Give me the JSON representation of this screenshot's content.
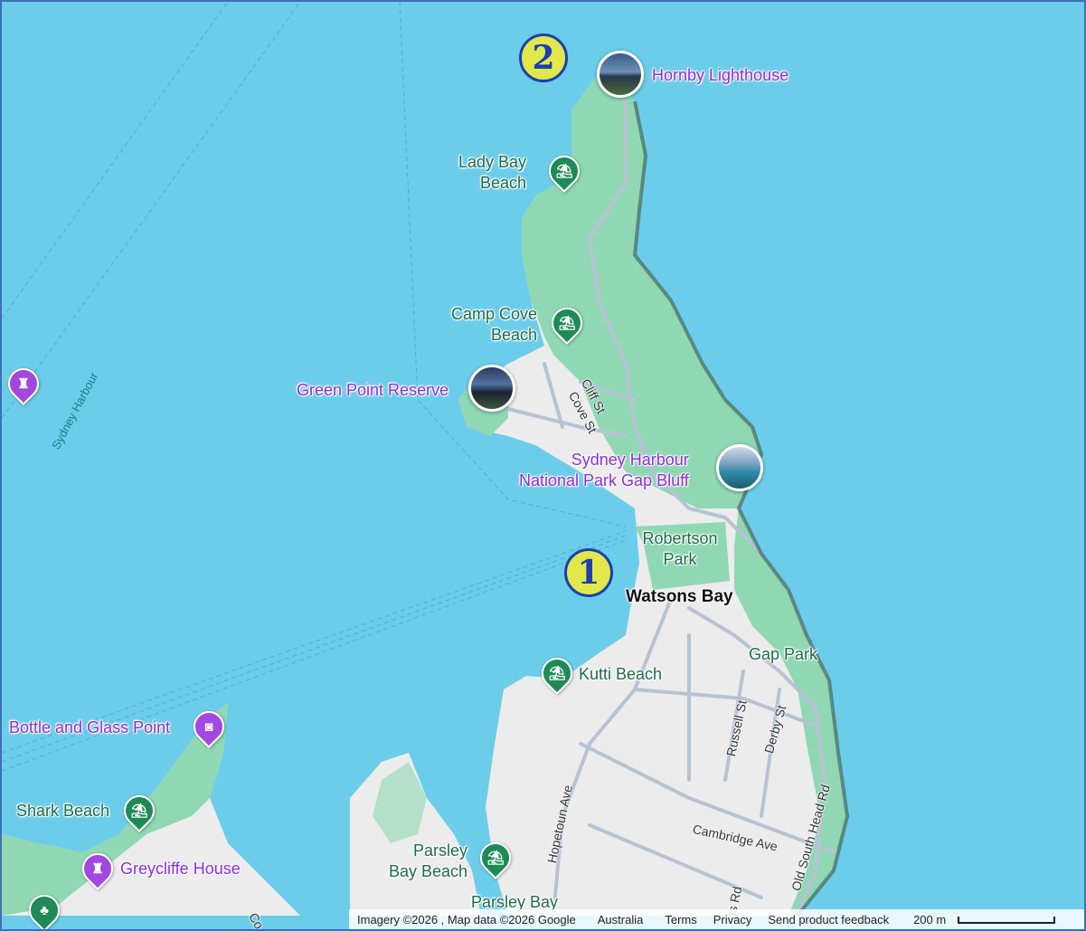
{
  "map": {
    "places": {
      "hornby_lighthouse": "Hornby Lighthouse",
      "lady_bay_beach": [
        "Lady Bay",
        "Beach"
      ],
      "camp_cove_beach": [
        "Camp Cove",
        "Beach"
      ],
      "green_point_reserve": "Green Point Reserve",
      "gap_bluff": [
        "Sydney Harbour",
        "National Park Gap Bluff"
      ],
      "robertson_park": [
        "Robertson",
        "Park"
      ],
      "watsons_bay": "Watsons Bay",
      "gap_park": "Gap Park",
      "kutti_beach": "Kutti Beach",
      "bottle_glass_point": "Bottle and Glass Point",
      "shark_beach": "Shark Beach",
      "greycliffe_house": "Greycliffe House",
      "parsley_bay_beach": [
        "Parsley",
        "Bay Beach"
      ],
      "parsley_bay": "Parsley Bay"
    },
    "water_label": "Sydney Harbour",
    "streets": {
      "cliff_st": "Cliff St",
      "cove_st": "Cove St",
      "hopetoun_ave": "Hopetoun Ave",
      "russell_st": "Russell St",
      "derby_st": "Derby St",
      "cambridge_ave": "Cambridge Ave",
      "old_south_head_rd": "Old South Head Rd",
      "clip_left": "Co",
      "clip_right": "gs Rd"
    },
    "markers": {
      "marker_1": "1",
      "marker_2": "2"
    },
    "icons": {
      "beach": "beach-umbrella-icon",
      "landmark": "castle-icon",
      "camera": "camera-icon",
      "park": "tree-icon"
    },
    "colors": {
      "water": "#6ccdea",
      "park": "#8fd8b3",
      "land": "#eeeeee",
      "label_purple": "#8a2be2",
      "label_green": "#1d6b4c",
      "marker_fill": "#e2e84a",
      "marker_border": "#1c3fb0"
    }
  },
  "footer": {
    "imagery": "Imagery ©2026 , Map data ©2026 Google",
    "country": "Australia",
    "terms": "Terms",
    "privacy": "Privacy",
    "feedback": "Send product feedback",
    "scale": "200 m"
  }
}
